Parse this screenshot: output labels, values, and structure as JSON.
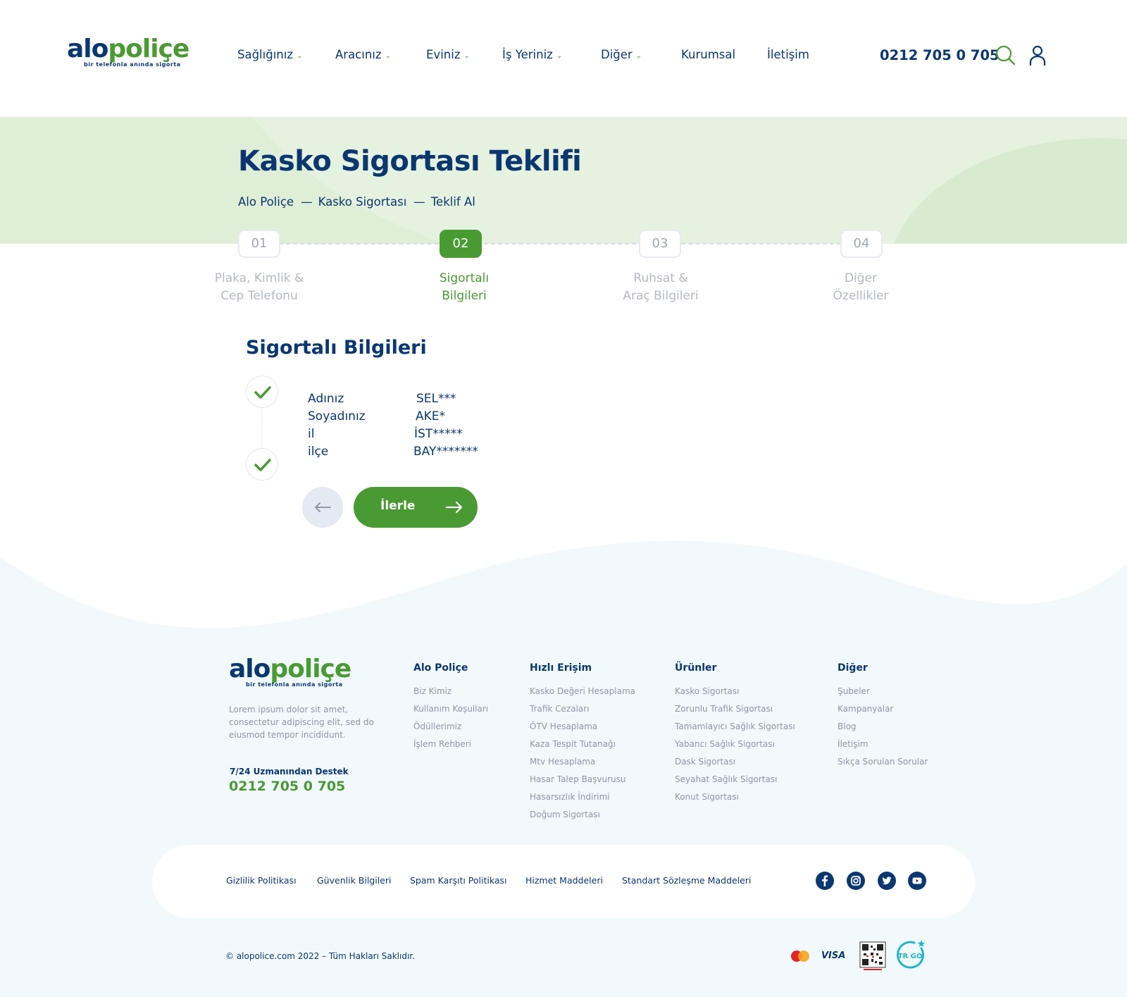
{
  "brand": {
    "logo_part1": "alo",
    "logo_part2": "poliçe",
    "tagline": "bir telefonla anında sigorta",
    "navy": "#0a3770",
    "green": "#4a9a33"
  },
  "header": {
    "nav": [
      {
        "label": "Sağlığınız",
        "has_dropdown": true
      },
      {
        "label": "Aracınız",
        "has_dropdown": true
      },
      {
        "label": "Eviniz",
        "has_dropdown": true
      },
      {
        "label": "İş Yeriniz",
        "has_dropdown": true
      },
      {
        "label": "Diğer",
        "has_dropdown": true
      },
      {
        "label": "Kurumsal",
        "has_dropdown": false
      },
      {
        "label": "İletişim",
        "has_dropdown": false
      }
    ],
    "dropdown_icon": "chevron-down-icon",
    "phone": "0212 705 0 705",
    "search_icon": "search-icon",
    "user_icon": "user-icon"
  },
  "hero": {
    "title": "Kasko Sigortası Teklifi",
    "breadcrumb": [
      "Alo Poliçe",
      "Kasko Sigortası",
      "Teklif Al"
    ],
    "breadcrumb_separator": "—"
  },
  "steps": [
    {
      "number": "01",
      "line1": "Plaka, Kimlik &",
      "line2": "Cep Telefonu",
      "active": false
    },
    {
      "number": "02",
      "line1": "Sigortalı",
      "line2": "Bilgileri",
      "active": true
    },
    {
      "number": "03",
      "line1": "Ruhsat &",
      "line2": "Araç Bilgileri",
      "active": false
    },
    {
      "number": "04",
      "line1": "Diğer",
      "line2": "Özellikler",
      "active": false
    }
  ],
  "form": {
    "title": "Sigortalı Bilgileri",
    "rows": [
      {
        "label": "Adınız",
        "value": "SEL***"
      },
      {
        "label": "Soyadınız",
        "value": "AKE*"
      },
      {
        "label": "il",
        "value": "İST*****"
      },
      {
        "label": "ilçe",
        "value": "BAY*******"
      }
    ],
    "next_label": "İlerle",
    "back_icon": "arrow-left-icon",
    "next_icon": "arrow-right-icon"
  },
  "footer": {
    "description": "Lorem ipsum dolor sit amet, consectetur adipiscing elit, sed do eiusmod tempor incididunt.",
    "support_label": "7/24 Uzmanından Destek",
    "support_phone": "0212 705 0 705",
    "columns": [
      {
        "title": "Alo Poliçe",
        "links": [
          "Biz Kimiz",
          "Kullanım Koşulları",
          "Ödüllerimiz",
          "İşlem Rehberi"
        ]
      },
      {
        "title": "Hızlı Erişim",
        "links": [
          "Kasko Değeri Hesaplama",
          "Trafik Cezaları",
          "ÖTV Hesaplama",
          "Kaza Tespit Tutanağı",
          "Mtv Hesaplama",
          "Hasar Talep Başvurusu",
          "Hasarsızlık İndirimi",
          "Doğum Sigortası"
        ]
      },
      {
        "title": "Ürünler",
        "links": [
          "Kasko Sigortası",
          "Zorunlu Trafik Sigortası",
          "Tamamlayıcı Sağlık Sigortası",
          "Yabancı Sağlık Sigortası",
          "Dask Sigortası",
          "Seyahat Sağlık Sigortası",
          "Konut Sigortası"
        ]
      },
      {
        "title": "Diğer",
        "links": [
          "Şubeler",
          "Kampanyalar",
          "Blog",
          "İletişim",
          "Sıkça Sorulan Sorular"
        ]
      }
    ],
    "legal_links": [
      "Gizlilik Politikası",
      "Güvenlik Bilgileri",
      "Spam Karşıtı Politikası",
      "Hizmet Maddeleri",
      "Standart Sözleşme Maddeleri"
    ],
    "social": [
      "facebook-icon",
      "instagram-icon",
      "twitter-icon",
      "youtube-icon"
    ],
    "copyright": "© alopolice.com 2022 – Tüm Hakları Saklıdır.",
    "payment": {
      "visa_text": "VISA",
      "trgo_text": "TR GO",
      "icons": [
        "mastercard-icon",
        "visa-icon",
        "etbis-qr-icon",
        "trgo-icon"
      ]
    }
  }
}
